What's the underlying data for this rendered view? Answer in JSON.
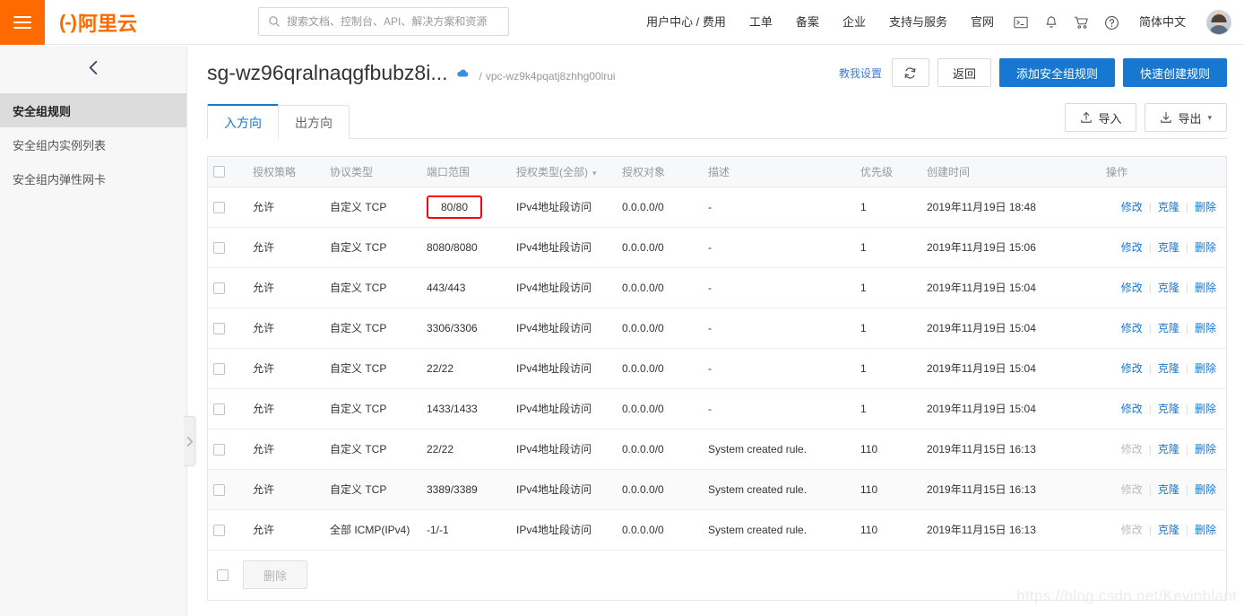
{
  "header": {
    "menu_icon": "hamburger-icon",
    "logo_text": "阿里云",
    "search_placeholder": "搜索文档、控制台、API、解决方案和资源",
    "nav": [
      {
        "label": "用户中心 / 费用"
      },
      {
        "label": "工单"
      },
      {
        "label": "备案"
      },
      {
        "label": "企业"
      },
      {
        "label": "支持与服务"
      },
      {
        "label": "官网"
      }
    ],
    "icons": [
      "terminal-icon",
      "bell-icon",
      "cart-icon",
      "help-icon"
    ],
    "language": "简体中文",
    "avatar": "user-avatar"
  },
  "sidebar": {
    "collapse_icon": "chevron-left-icon",
    "items": [
      {
        "label": "安全组规则",
        "active": true
      },
      {
        "label": "安全组内实例列表",
        "active": false
      },
      {
        "label": "安全组内弹性网卡",
        "active": false
      }
    ],
    "handle_icon": "chevron-right-icon"
  },
  "page": {
    "title": "sg-wz96qralnaqgfbubz8i...",
    "cloud_icon": "cloud-icon",
    "breadcrumb_sep": "/",
    "breadcrumb": "vpc-wz9k4pqatj8zhhg00lrui",
    "help_link": "教我设置",
    "refresh_icon": "refresh-icon",
    "back_button": "返回",
    "add_rule_button": "添加安全组规则",
    "quick_create_button": "快速创建规则"
  },
  "tabs": [
    {
      "label": "入方向",
      "active": true
    },
    {
      "label": "出方向",
      "active": false
    }
  ],
  "tab_actions": {
    "import_icon": "upload-icon",
    "import_label": "导入",
    "export_icon": "download-icon",
    "export_label": "导出",
    "export_caret": "▾"
  },
  "table": {
    "columns": [
      "",
      "授权策略",
      "协议类型",
      "端口范围",
      "授权类型(全部)",
      "授权对象",
      "描述",
      "优先级",
      "创建时间",
      "操作"
    ],
    "auth_type_caret": "▾",
    "ops": {
      "edit": "修改",
      "clone": "克隆",
      "delete": "删除",
      "sep": "|"
    },
    "rows": [
      {
        "policy": "允许",
        "protocol": "自定义 TCP",
        "port": "80/80",
        "highlight": true,
        "auth_type": "IPv4地址段访问",
        "target": "0.0.0.0/0",
        "desc": "-",
        "priority": "1",
        "created": "2019年11月19日 18:48",
        "edit_disabled": false,
        "alt": false
      },
      {
        "policy": "允许",
        "protocol": "自定义 TCP",
        "port": "8080/8080",
        "highlight": false,
        "auth_type": "IPv4地址段访问",
        "target": "0.0.0.0/0",
        "desc": "-",
        "priority": "1",
        "created": "2019年11月19日 15:06",
        "edit_disabled": false,
        "alt": false
      },
      {
        "policy": "允许",
        "protocol": "自定义 TCP",
        "port": "443/443",
        "highlight": false,
        "auth_type": "IPv4地址段访问",
        "target": "0.0.0.0/0",
        "desc": "-",
        "priority": "1",
        "created": "2019年11月19日 15:04",
        "edit_disabled": false,
        "alt": false
      },
      {
        "policy": "允许",
        "protocol": "自定义 TCP",
        "port": "3306/3306",
        "highlight": false,
        "auth_type": "IPv4地址段访问",
        "target": "0.0.0.0/0",
        "desc": "-",
        "priority": "1",
        "created": "2019年11月19日 15:04",
        "edit_disabled": false,
        "alt": false
      },
      {
        "policy": "允许",
        "protocol": "自定义 TCP",
        "port": "22/22",
        "highlight": false,
        "auth_type": "IPv4地址段访问",
        "target": "0.0.0.0/0",
        "desc": "-",
        "priority": "1",
        "created": "2019年11月19日 15:04",
        "edit_disabled": false,
        "alt": false
      },
      {
        "policy": "允许",
        "protocol": "自定义 TCP",
        "port": "1433/1433",
        "highlight": false,
        "auth_type": "IPv4地址段访问",
        "target": "0.0.0.0/0",
        "desc": "-",
        "priority": "1",
        "created": "2019年11月19日 15:04",
        "edit_disabled": false,
        "alt": false
      },
      {
        "policy": "允许",
        "protocol": "自定义 TCP",
        "port": "22/22",
        "highlight": false,
        "auth_type": "IPv4地址段访问",
        "target": "0.0.0.0/0",
        "desc": "System created rule.",
        "priority": "110",
        "created": "2019年11月15日 16:13",
        "edit_disabled": true,
        "alt": false
      },
      {
        "policy": "允许",
        "protocol": "自定义 TCP",
        "port": "3389/3389",
        "highlight": false,
        "auth_type": "IPv4地址段访问",
        "target": "0.0.0.0/0",
        "desc": "System created rule.",
        "priority": "110",
        "created": "2019年11月15日 16:13",
        "edit_disabled": true,
        "alt": true
      },
      {
        "policy": "允许",
        "protocol": "全部 ICMP(IPv4)",
        "port": "-1/-1",
        "highlight": false,
        "auth_type": "IPv4地址段访问",
        "target": "0.0.0.0/0",
        "desc": "System created rule.",
        "priority": "110",
        "created": "2019年11月15日 16:13",
        "edit_disabled": true,
        "alt": false
      }
    ]
  },
  "footer": {
    "delete_button": "删除"
  },
  "watermark": "https://blog.csdn.net/Kevinblant",
  "colors": {
    "brand_orange": "#ff6a00",
    "primary_blue": "#1678d1",
    "highlight_red": "#fb0007",
    "active_sidebar": "#dcdcdc"
  }
}
